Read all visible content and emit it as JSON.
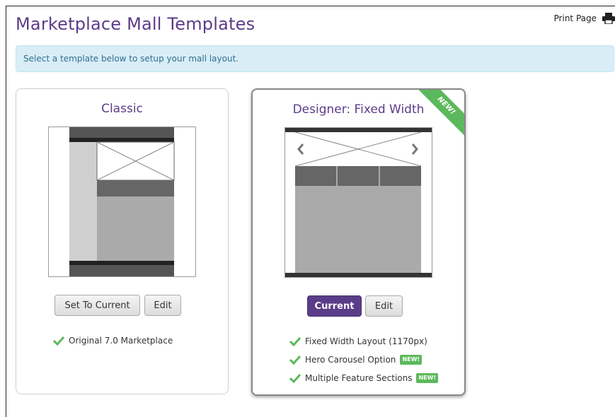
{
  "page": {
    "title": "Marketplace Mall Templates",
    "print_label": "Print Page",
    "info_message": "Select a template below to setup your mall layout."
  },
  "templates": [
    {
      "name": "Classic",
      "buttons": {
        "set_current": "Set To Current",
        "edit": "Edit"
      },
      "features": [
        {
          "text": "Original 7.0 Marketplace"
        }
      ]
    },
    {
      "name": "Designer: Fixed Width",
      "ribbon": "NEW!",
      "buttons": {
        "current": "Current",
        "edit": "Edit"
      },
      "features": [
        {
          "text": "Fixed Width Layout (1170px)"
        },
        {
          "text": "Hero Carousel Option",
          "badge": "NEW!"
        },
        {
          "text": "Multiple Feature Sections",
          "badge": "NEW!"
        }
      ]
    }
  ],
  "colors": {
    "accent": "#5b3c88",
    "success": "#5cb85c",
    "info_bg": "#d9edf7",
    "info_text": "#31708f"
  },
  "icons": {
    "print": "printer-icon",
    "check": "checkmark-icon"
  }
}
